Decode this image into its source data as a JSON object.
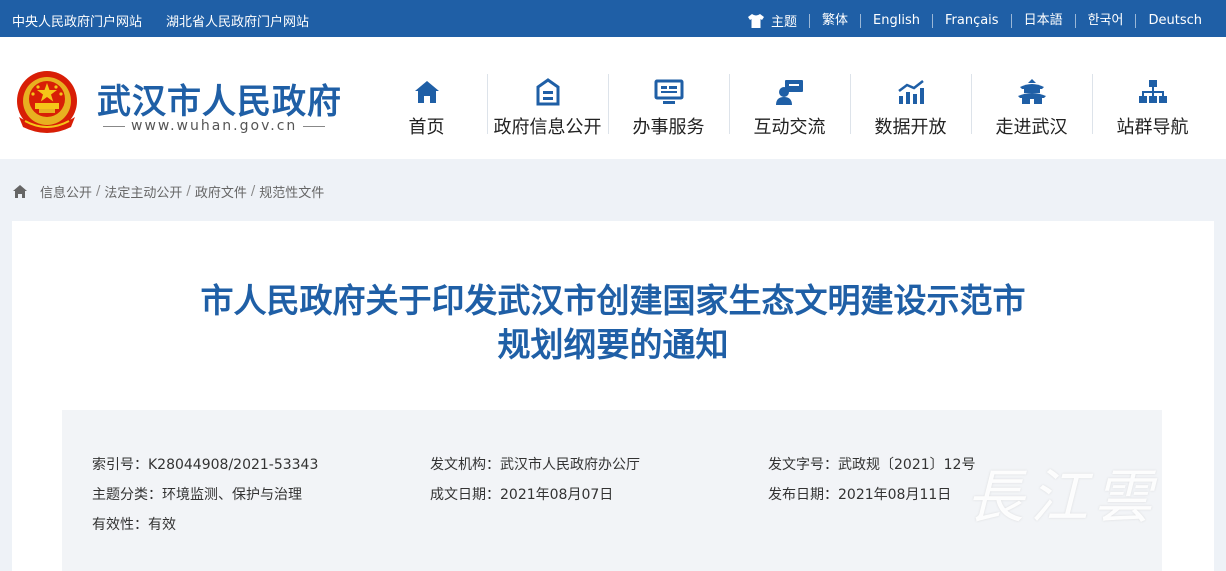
{
  "topbar": {
    "links": [
      "中央人民政府门户网站",
      "湖北省人民政府门户网站"
    ],
    "theme_label": "主题",
    "languages": [
      "繁体",
      "English",
      "Français",
      "日本語",
      "한국어",
      "Deutsch"
    ]
  },
  "header": {
    "site_title": "武汉市人民政府",
    "site_url": "www.wuhan.gov.cn"
  },
  "nav": [
    {
      "label": "首页",
      "icon": "home-icon"
    },
    {
      "label": "政府信息公开",
      "icon": "document-icon"
    },
    {
      "label": "办事服务",
      "icon": "monitor-icon"
    },
    {
      "label": "互动交流",
      "icon": "chat-icon"
    },
    {
      "label": "数据开放",
      "icon": "chart-icon"
    },
    {
      "label": "走进武汉",
      "icon": "pavilion-icon"
    },
    {
      "label": "站群导航",
      "icon": "sitemap-icon"
    }
  ],
  "breadcrumb": [
    "信息公开",
    "法定主动公开",
    "政府文件",
    "规范性文件"
  ],
  "article": {
    "title_line1": "市人民政府关于印发武汉市创建国家生态文明建设示范市",
    "title_line2": "规划纲要的通知"
  },
  "meta": {
    "index_no_label": "索引号：",
    "index_no": "K28044908/2021-53343",
    "issuer_label": "发文机构：",
    "issuer": "武汉市人民政府办公厅",
    "doc_no_label": "发文字号：",
    "doc_no": "武政规〔2021〕12号",
    "topic_label": "主题分类：",
    "topic": "环境监测、保护与治理",
    "created_label": "成文日期：",
    "created": "2021年08月07日",
    "published_label": "发布日期：",
    "published": "2021年08月11日",
    "validity_label": "有效性：",
    "validity": "有效"
  },
  "watermark": "長江雲",
  "colors": {
    "brand_blue": "#1f5fa6",
    "page_bg": "#eef2f7",
    "meta_bg": "#f2f4f7"
  }
}
